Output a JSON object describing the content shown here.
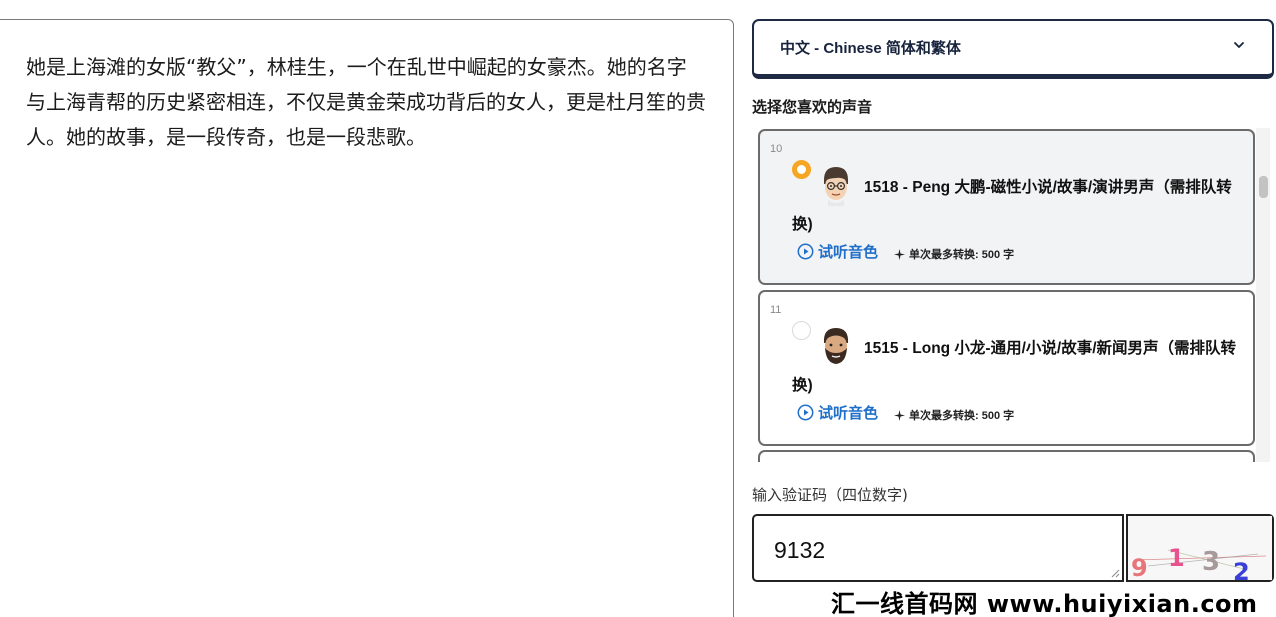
{
  "editor": {
    "text": "她是上海滩的女版“教父”，林桂生，一个在乱世中崛起的女豪杰。她的名字与上海青帮的历史紧密相连，不仅是黄金荣成功背后的女人，更是杜月笙的贵人。她的故事，是一段传奇，也是一段悲歌。"
  },
  "language_select": {
    "selected": "中文 - Chinese 简体和繁体",
    "icon": "chevron-down-icon"
  },
  "voice_section": {
    "label": "选择您喜欢的声音",
    "voices": [
      {
        "index": "10",
        "name": "1518 - Peng 大鹏-磁性小说/故事/演讲男声（需排队转换)",
        "selected": true,
        "preview_label": "试听音色",
        "limit_label": "单次最多转换: 500 字"
      },
      {
        "index": "11",
        "name": "1515 - Long 小龙-通用/小说/故事/新闻男声（需排队转换)",
        "selected": false,
        "preview_label": "试听音色",
        "limit_label": "单次最多转换: 500 字"
      }
    ]
  },
  "captcha": {
    "label": "输入验证码（四位数字)",
    "value": "9132",
    "image_digits": [
      "9",
      "1",
      "3",
      "2"
    ],
    "digit_colors": [
      "#e8757a",
      "#e8528d",
      "#a89a9a",
      "#3a3fd6"
    ]
  },
  "watermark": {
    "text": "汇一线首码网 www.huiyixian.com"
  },
  "colors": {
    "accent_orange": "#f5a623",
    "link_blue": "#1f6fc9",
    "dark_navy": "#1e2a44"
  }
}
